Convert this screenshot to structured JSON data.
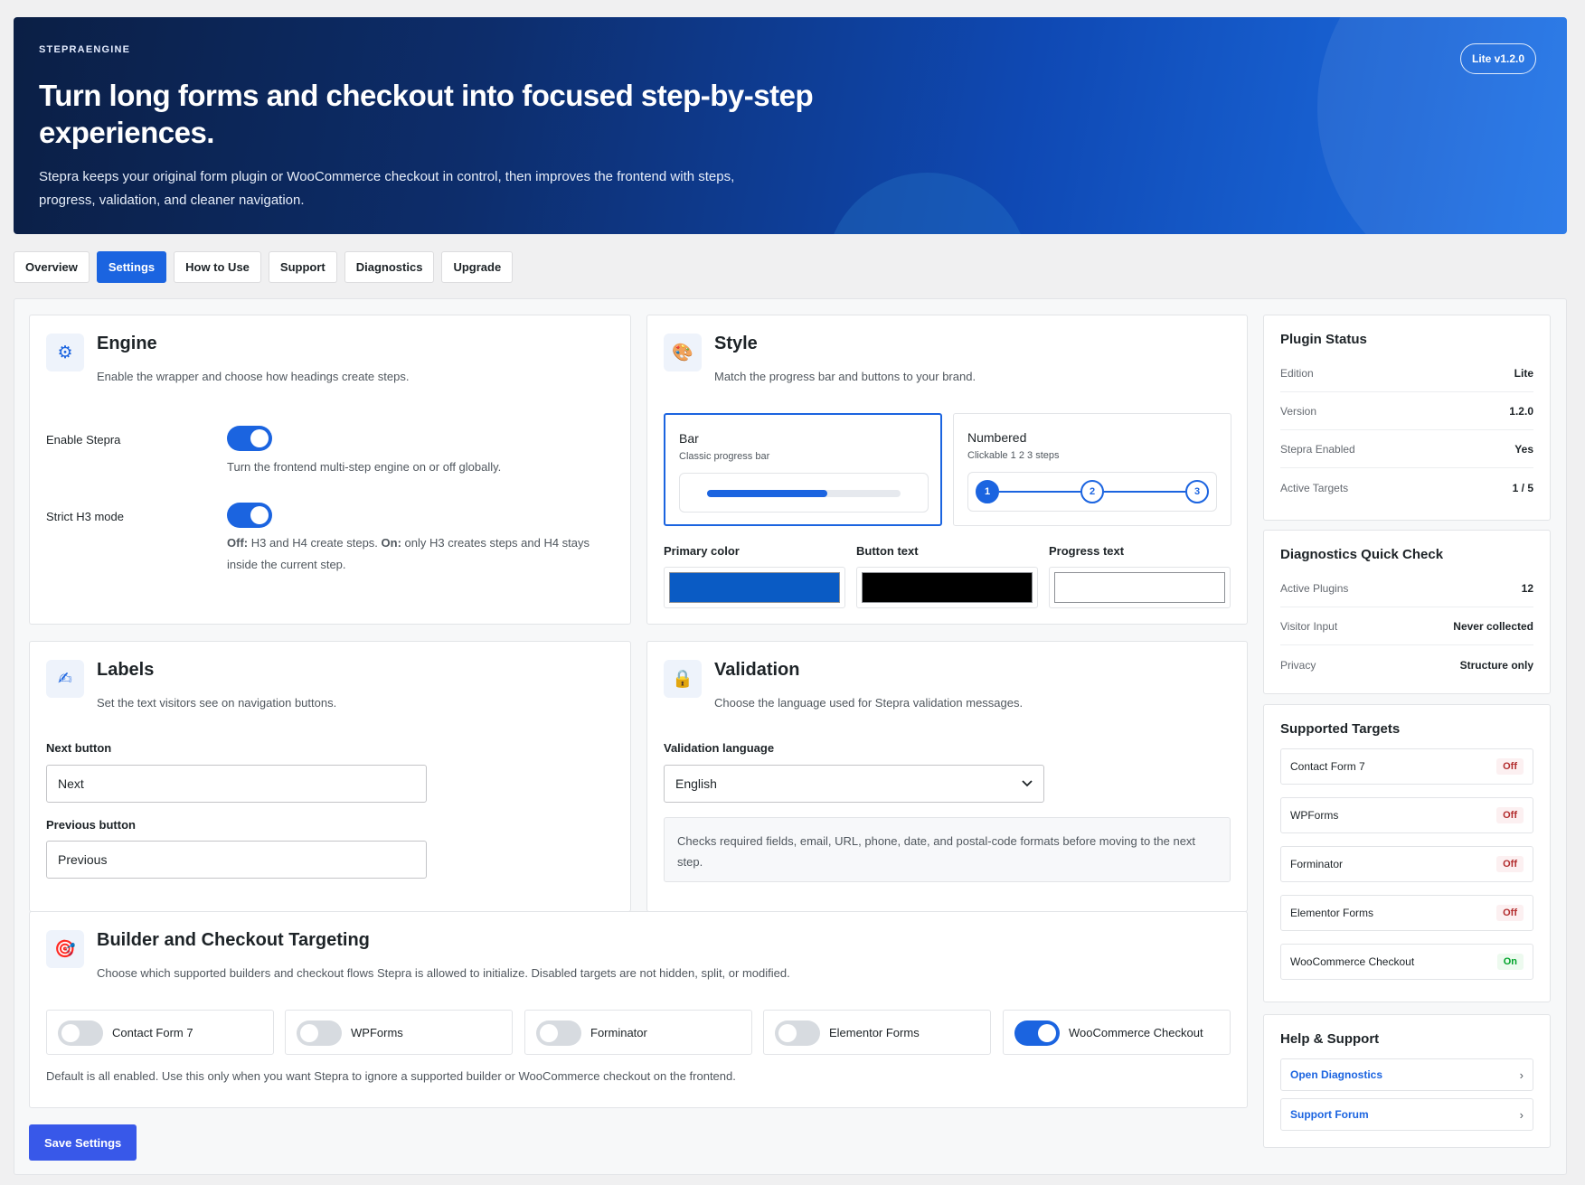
{
  "hero": {
    "brand": "STEPRAENGINE",
    "title": "Turn long forms and checkout into focused step-by-step experiences.",
    "lead": "Stepra keeps your original form plugin or WooCommerce checkout in control, then improves the frontend with steps, progress, validation, and cleaner navigation.",
    "version_badge": "Lite v1.2.0"
  },
  "tabs": [
    {
      "label": "Overview",
      "active": false
    },
    {
      "label": "Settings",
      "active": true
    },
    {
      "label": "How to Use",
      "active": false
    },
    {
      "label": "Support",
      "active": false
    },
    {
      "label": "Diagnostics",
      "active": false
    },
    {
      "label": "Upgrade",
      "active": false
    }
  ],
  "engine": {
    "icon": "gear-icon",
    "title": "Engine",
    "subtitle": "Enable the wrapper and choose how headings create steps.",
    "enable_label": "Enable Stepra",
    "enable_on": true,
    "enable_help": "Turn the frontend multi-step engine on or off globally.",
    "strict_label": "Strict H3 mode",
    "strict_on": true,
    "strict_help_off": "Off:",
    "strict_help_mid": " H3 and H4 create steps. ",
    "strict_help_on": "On:",
    "strict_help_end": " only H3 creates steps and H4 stays inside the current step."
  },
  "style": {
    "icon": "palette-icon",
    "title": "Style",
    "subtitle": "Match the progress bar and buttons to your brand.",
    "options": [
      {
        "title": "Bar",
        "desc": "Classic progress bar",
        "selected": true,
        "progress": 0.62
      },
      {
        "title": "Numbered",
        "desc": "Clickable 1 2 3 steps",
        "selected": false,
        "steps": [
          "1",
          "2",
          "3"
        ],
        "current": 1
      }
    ],
    "colors": [
      {
        "label": "Primary color",
        "value": "#0a5bc4"
      },
      {
        "label": "Button text",
        "value": "#000000"
      },
      {
        "label": "Progress text",
        "value": "#ffffff"
      }
    ]
  },
  "labels": {
    "icon": "pen-icon",
    "title": "Labels",
    "subtitle": "Set the text visitors see on navigation buttons.",
    "next_label": "Next button",
    "next_value": "Next",
    "prev_label": "Previous button",
    "prev_value": "Previous"
  },
  "validation": {
    "icon": "lock-icon",
    "title": "Validation",
    "subtitle": "Choose the language used for Stepra validation messages.",
    "lang_label": "Validation language",
    "lang_value": "English",
    "info": "Checks required fields, email, URL, phone, date, and postal-code formats before moving to the next step."
  },
  "targeting": {
    "icon": "target-icon",
    "title": "Builder and Checkout Targeting",
    "subtitle": "Choose which supported builders and checkout flows Stepra is allowed to initialize. Disabled targets are not hidden, split, or modified.",
    "items": [
      {
        "label": "Contact Form 7",
        "on": false
      },
      {
        "label": "WPForms",
        "on": false
      },
      {
        "label": "Forminator",
        "on": false
      },
      {
        "label": "Elementor Forms",
        "on": false
      },
      {
        "label": "WooCommerce Checkout",
        "on": true
      }
    ],
    "note": "Default is all enabled. Use this only when you want Stepra to ignore a supported builder or WooCommerce checkout on the frontend."
  },
  "save_label": "Save Settings",
  "plugin_status": {
    "title": "Plugin Status",
    "rows": [
      {
        "k": "Edition",
        "v": "Lite"
      },
      {
        "k": "Version",
        "v": "1.2.0"
      },
      {
        "k": "Stepra Enabled",
        "v": "Yes"
      },
      {
        "k": "Active Targets",
        "v": "1 / 5"
      }
    ]
  },
  "diagnostics": {
    "title": "Diagnostics Quick Check",
    "rows": [
      {
        "k": "Active Plugins",
        "v": "12"
      },
      {
        "k": "Visitor Input",
        "v": "Never collected"
      },
      {
        "k": "Privacy",
        "v": "Structure only"
      }
    ]
  },
  "supported": {
    "title": "Supported Targets",
    "rows": [
      {
        "label": "Contact Form 7",
        "status": "Off"
      },
      {
        "label": "WPForms",
        "status": "Off"
      },
      {
        "label": "Forminator",
        "status": "Off"
      },
      {
        "label": "Elementor Forms",
        "status": "Off"
      },
      {
        "label": "WooCommerce Checkout",
        "status": "On"
      }
    ]
  },
  "help": {
    "title": "Help & Support",
    "links": [
      {
        "label": "Open Diagnostics",
        "icon": "chevron-right-icon"
      },
      {
        "label": "Support Forum",
        "icon": "chevron-right-icon"
      }
    ]
  }
}
